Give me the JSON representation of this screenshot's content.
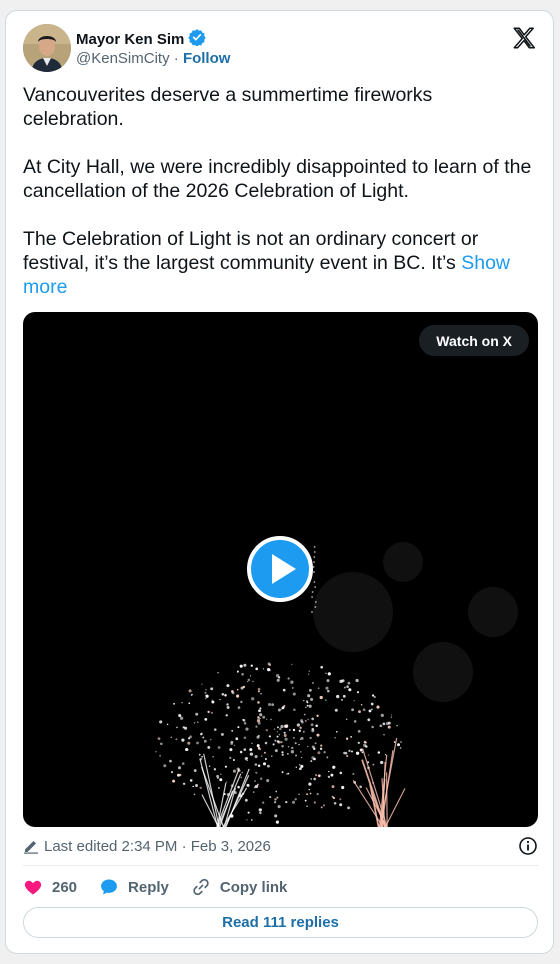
{
  "author": {
    "name": "Mayor Ken Sim",
    "handle": "@KenSimCity",
    "separator": "·",
    "follow_label": "Follow",
    "verified": true
  },
  "tweet": {
    "paragraphs": [
      "Vancouverites deserve a summertime fireworks celebration.",
      "At City Hall, we were incredibly disappointed to learn of the cancellation of the 2026 Celebration of Light.",
      "The Celebration of Light is not an ordinary concert or festival, it’s the largest community event in BC. It’s"
    ],
    "show_more_label": "Show more"
  },
  "media": {
    "watch_label": "Watch on X",
    "play_icon": "play-icon"
  },
  "meta": {
    "edited_label": "Last edited 2:34 PM · Feb 3, 2026"
  },
  "actions": {
    "like_count": "260",
    "reply_label": "Reply",
    "copy_label": "Copy link"
  },
  "read_replies_label": "Read 111 replies",
  "colors": {
    "link": "#1d9bf0",
    "follow": "#1d6fa8",
    "heart": "#f91880",
    "reply_bubble": "#1d9bf0",
    "verified": "#1d9bf0"
  }
}
